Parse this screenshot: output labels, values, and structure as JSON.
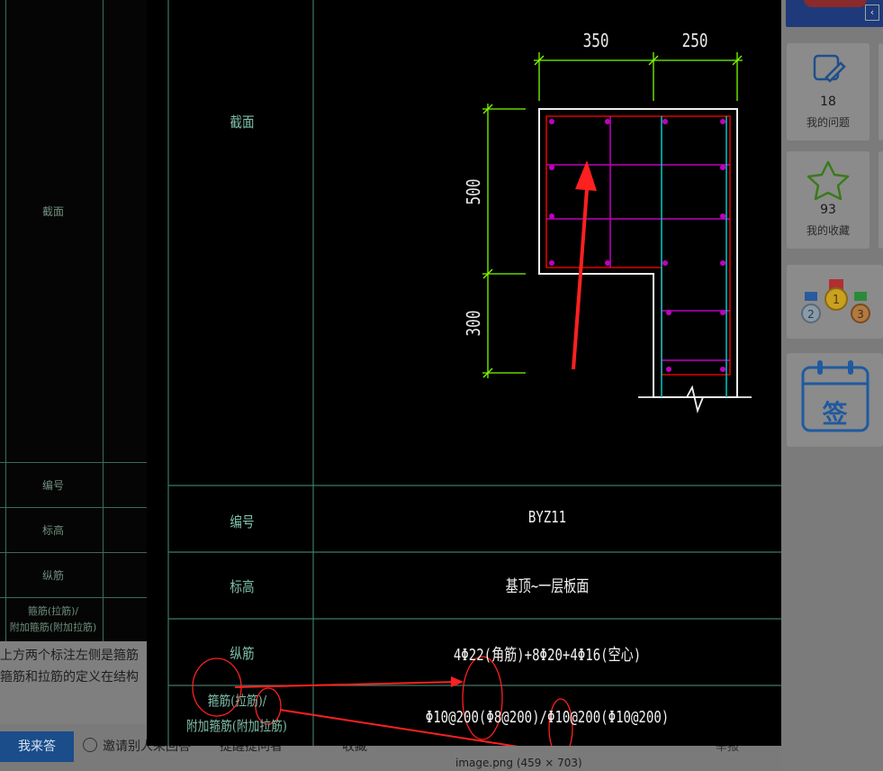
{
  "background": {
    "cad_labels": [
      "截面",
      "编号",
      "标高",
      "纵筋",
      "箍筋(拉筋)/",
      "附加箍筋(附加拉筋)"
    ],
    "question_lines": [
      "上方两个标注左侧是箍筋",
      "箍筋和拉筋的定义在结构"
    ]
  },
  "actions": {
    "answer_label": "我来答",
    "invite_label": "邀请别人来回答",
    "remind_label": "提醒提问者",
    "collect_label": "收藏",
    "report_label": "举报"
  },
  "image_caption": "image.png (459 × 703)",
  "sidebar": {
    "my_questions_count": "18",
    "my_questions_label": "我的问题",
    "my_favorites_count": "93",
    "my_favorites_label": "我的收藏",
    "sign_label": "签",
    "collapse_icon": "chevron-left"
  },
  "drawing": {
    "row_labels": {
      "section": "截面",
      "id": "编号",
      "elevation": "标高",
      "long_bar": "纵筋",
      "stirrup": "箍筋(拉筋)/",
      "stirrup_add": "附加箍筋(附加拉筋)"
    },
    "values": {
      "id": "BYZ11",
      "elevation": "基顶~一层板面",
      "long_bar": "4Φ22(角筋)+8Φ20+4Φ16(空心)",
      "stirrup": "Φ10@200(Φ8@200)/Φ10@200(Φ10@200)"
    },
    "dims": {
      "top_left": "350",
      "top_right": "250",
      "left_top": "500",
      "left_bottom": "300"
    }
  },
  "colors": {
    "cad_line": "#3d7a68",
    "label_green": "#7fbfa8",
    "stirrup_magenta": "#c000c0",
    "rebar_red": "#e00000",
    "tie_cyan": "#00c8c8",
    "dim_green": "#7cfc00",
    "annotation_red": "#ff2020",
    "answer_btn": "#1a4d8a"
  }
}
